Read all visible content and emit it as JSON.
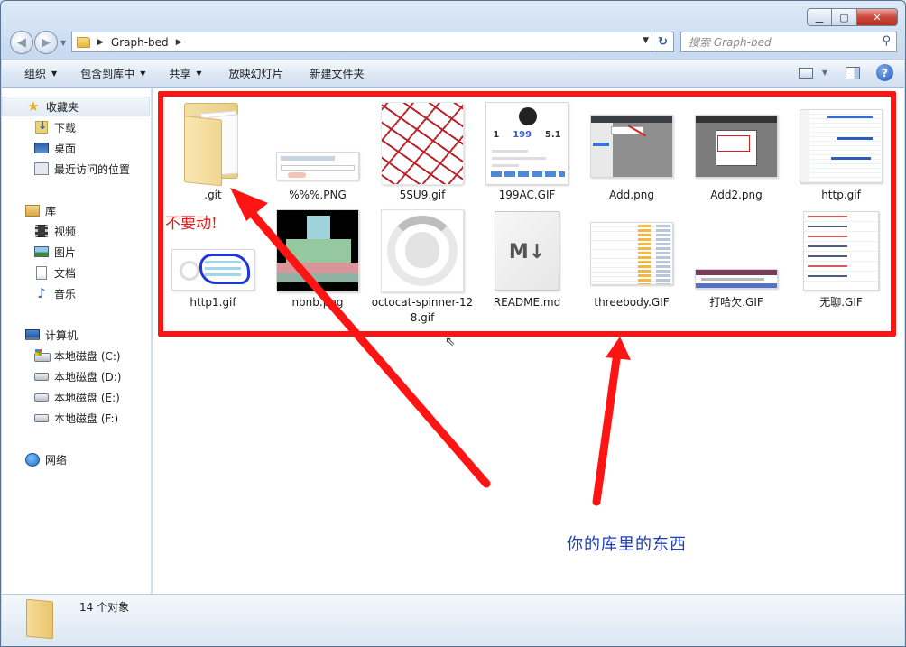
{
  "window": {
    "address_path": "Graph-bed",
    "search_placeholder": "搜索 Graph-bed"
  },
  "toolbar": {
    "organize": "组织",
    "include_in_library": "包含到库中",
    "share": "共享",
    "slideshow": "放映幻灯片",
    "new_folder": "新建文件夹"
  },
  "sidebar": {
    "favorites": "收藏夹",
    "downloads": "下载",
    "desktop": "桌面",
    "recent": "最近访问的位置",
    "libraries": "库",
    "videos": "视频",
    "pictures": "图片",
    "documents": "文档",
    "music": "音乐",
    "computer": "计算机",
    "drive_c": "本地磁盘 (C:)",
    "drive_d": "本地磁盘 (D:)",
    "drive_e": "本地磁盘 (E:)",
    "drive_f": "本地磁盘 (F:)",
    "network": "网络"
  },
  "files": [
    {
      "name": ".git"
    },
    {
      "name": "%%%.PNG"
    },
    {
      "name": "5SU9.gif"
    },
    {
      "name": "199AC.GIF",
      "stats": [
        "1",
        "199",
        "5.1"
      ]
    },
    {
      "name": "Add.png"
    },
    {
      "name": "Add2.png"
    },
    {
      "name": "http.gif"
    },
    {
      "name": "http1.gif"
    },
    {
      "name": "nbnb.png"
    },
    {
      "name": "octocat-spinner-128.gif"
    },
    {
      "name": "README.md",
      "badge": "M↓"
    },
    {
      "name": "threebody.GIF"
    },
    {
      "name": "打哈欠.GIF"
    },
    {
      "name": "无聊.GIF"
    }
  ],
  "annotations": {
    "dont_move": "不要动!",
    "your_stuff": "你的库里的东西",
    "highlight_color": "#ff1414"
  },
  "status": {
    "item_count": "14 个对象"
  }
}
